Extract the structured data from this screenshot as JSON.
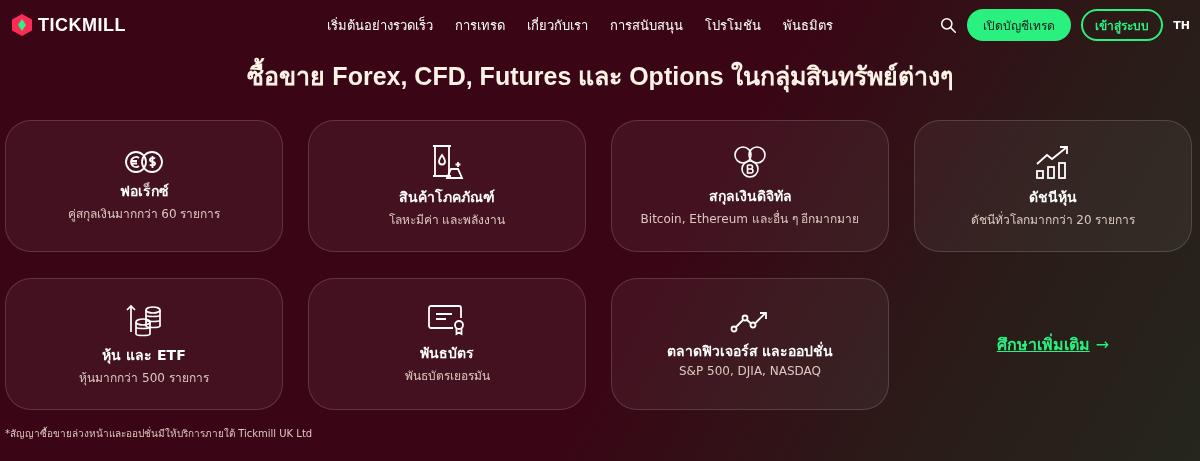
{
  "header": {
    "logo": "TICKMILL",
    "nav": [
      "เริ่มต้นอย่างรวดเร็ว",
      "การเทรด",
      "เกี่ยวกับเรา",
      "การสนับสนุน",
      "โปรโมชัน",
      "พันธมิตร"
    ],
    "open_account": "เปิดบัญชีเทรด",
    "login": "เข้าสู่ระบบ",
    "language": "TH"
  },
  "title": "ซื้อขาย Forex, CFD, Futures และ Options ในกลุ่มสินทรัพย์ต่างๆ",
  "cards": [
    {
      "name": "ฟอเร็กซ์",
      "detail": "คู่สกุลเงินมากกว่า 60 รายการ"
    },
    {
      "name": "สินค้าโภคภัณฑ์",
      "detail": "โลหะมีค่า และพลังงาน"
    },
    {
      "name": "สกุลเงินดิจิทัล",
      "detail": "Bitcoin, Ethereum และอื่น ๆ อีกมากมาย"
    },
    {
      "name": "ดัชนีหุ้น",
      "detail": "ดัชนีทั่วโลกมากกว่า 20 รายการ"
    },
    {
      "name": "หุ้น และ ETF",
      "detail": "หุ้นมากกว่า 500 รายการ"
    },
    {
      "name": "พันธบัตร",
      "detail": "พันธบัตรเยอรมัน"
    },
    {
      "name": "ตลาดฟิวเจอร์ส และออปชั่น",
      "detail": "S&P 500, DJIA, NASDAQ"
    }
  ],
  "more_link": {
    "label": "ศึกษาเพิ่มเติม",
    "arrow": "→"
  },
  "footnote": "*สัญญาซื้อขายล่วงหน้าและออปชั่นมีให้บริการภายใต้ Tickmill UK Ltd"
}
